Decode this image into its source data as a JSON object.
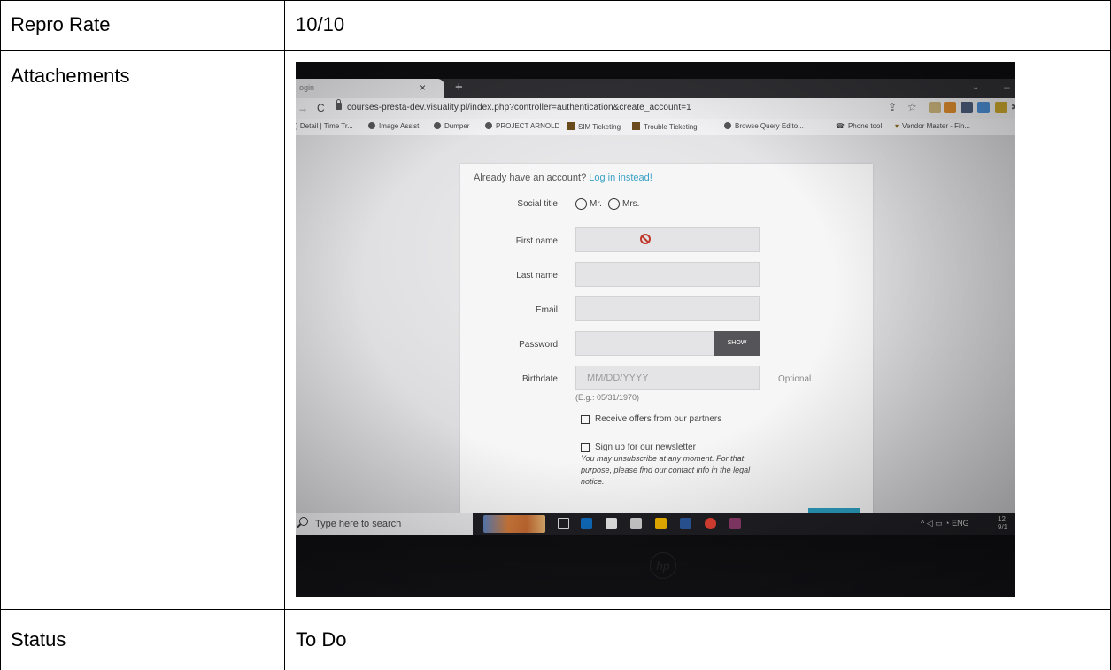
{
  "table": {
    "rows": [
      {
        "label": "Repro Rate",
        "value": "10/10"
      },
      {
        "label": "Attachements",
        "value": ""
      },
      {
        "label": "Status",
        "value": "To Do"
      }
    ]
  },
  "photo": {
    "browser": {
      "tab_title": "ogin",
      "tab_close": "×",
      "new_tab": "+",
      "url": "courses-presta-dev.visuality.pl/index.php?controller=authentication&create_account=1",
      "bookmarks": [
        ") Detail | Time Tr...",
        "Image Assist",
        "Dumper",
        "PROJECT ARNOLD",
        "SIM Ticketing",
        "Trouble Ticketing",
        "Browse Query Edito...",
        "Phone tool",
        "Vendor Master - Fin..."
      ]
    },
    "form": {
      "already_text": "Already have an account?",
      "login_link": "Log in instead!",
      "social_title_label": "Social title",
      "social_options": [
        "Mr.",
        "Mrs."
      ],
      "first_name_label": "First name",
      "last_name_label": "Last name",
      "email_label": "Email",
      "password_label": "Password",
      "show_button": "SHOW",
      "birthdate_label": "Birthdate",
      "birthdate_placeholder": "MM/DD/YYYY",
      "optional_label": "Optional",
      "birthdate_example": "(E.g.: 05/31/1970)",
      "offers_label": "Receive offers from our partners",
      "newsletter_label": "Sign up for our newsletter",
      "newsletter_note": "You may unsubscribe at any moment. For that purpose, please find our contact info in the legal notice."
    },
    "taskbar": {
      "search_placeholder": "Type here to search",
      "tray_text": "ENG",
      "clock_line1": "12",
      "clock_line2": "9/1"
    },
    "colors": {
      "link": "#3aa1c4",
      "error_icon": "#c0392b",
      "submit_button": "#2b9fc0"
    }
  }
}
